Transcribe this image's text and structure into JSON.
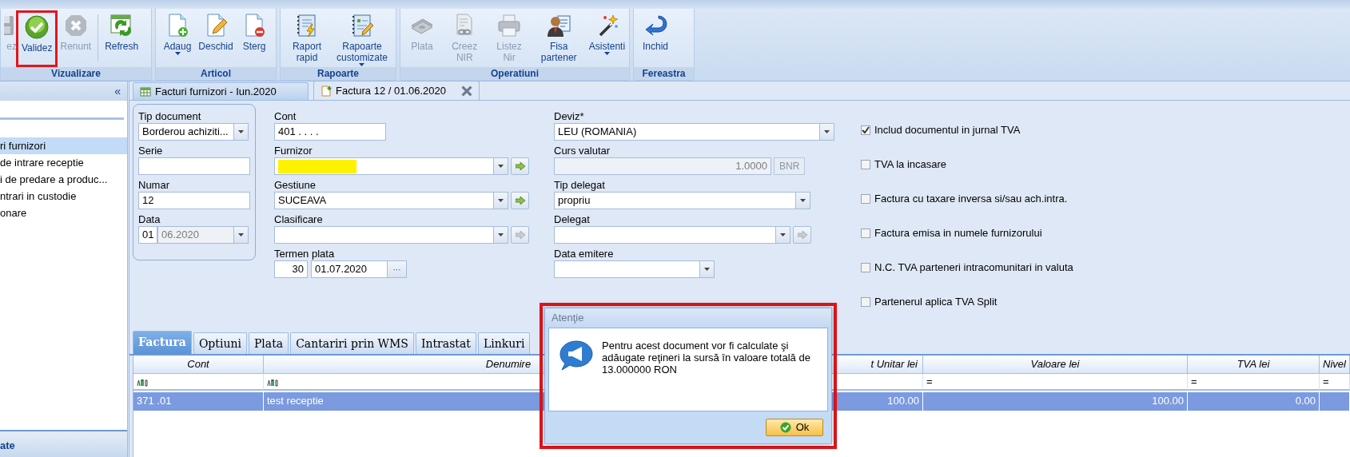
{
  "ribbon": {
    "groups": [
      {
        "label": "Vizualizare",
        "buttons": [
          {
            "label": "ez",
            "disabled": true,
            "highlighted": false,
            "dropdown": false
          },
          {
            "label": "Validez",
            "disabled": false,
            "highlighted": true,
            "dropdown": false
          },
          {
            "label": "Renunt",
            "disabled": true,
            "highlighted": false,
            "dropdown": false
          },
          {
            "label": "Refresh",
            "disabled": false,
            "highlighted": false,
            "dropdown": false
          }
        ]
      },
      {
        "label": "Articol",
        "buttons": [
          {
            "label": "Adaug",
            "disabled": false,
            "highlighted": false,
            "dropdown": true
          },
          {
            "label": "Deschid",
            "disabled": false,
            "highlighted": false,
            "dropdown": false
          },
          {
            "label": "Sterg",
            "disabled": false,
            "highlighted": false,
            "dropdown": false
          }
        ]
      },
      {
        "label": "Rapoarte",
        "buttons": [
          {
            "label": "Raport rapid",
            "disabled": false,
            "highlighted": false,
            "dropdown": false
          },
          {
            "label": "Rapoarte customizate",
            "disabled": false,
            "highlighted": false,
            "dropdown": true
          }
        ]
      },
      {
        "label": "Operatiuni",
        "buttons": [
          {
            "label": "Plata",
            "disabled": true,
            "highlighted": false,
            "dropdown": false
          },
          {
            "label": "Creez NIR",
            "disabled": true,
            "highlighted": false,
            "dropdown": false
          },
          {
            "label": "Listez Nir",
            "disabled": true,
            "highlighted": false,
            "dropdown": false
          },
          {
            "label": "Fisa partener",
            "disabled": false,
            "highlighted": false,
            "dropdown": false
          },
          {
            "label": "Asistenti",
            "disabled": false,
            "highlighted": false,
            "dropdown": true
          }
        ]
      },
      {
        "label": "Fereastra",
        "buttons": [
          {
            "label": "Inchid",
            "disabled": false,
            "highlighted": false,
            "dropdown": false
          }
        ]
      }
    ]
  },
  "sidebar": {
    "collapse": "«",
    "items": [
      {
        "label": "ri furnizori",
        "selected": true
      },
      {
        "label": "de intrare receptie",
        "selected": false
      },
      {
        "label": "i de predare a produc...",
        "selected": false
      },
      {
        "label": "ntrari in custodie",
        "selected": false
      },
      {
        "label": "onare",
        "selected": false
      }
    ],
    "footer": "ate"
  },
  "doc_tabs": [
    {
      "label": "Facturi furnizori - Iun.2020",
      "selected": false,
      "closable": false
    },
    {
      "label": "Factura 12 / 01.06.2020",
      "selected": true,
      "closable": true
    }
  ],
  "form": {
    "group": [
      {
        "label": "Tip document",
        "kind": "combo",
        "value": "Borderou achiziti..."
      },
      {
        "label": "Serie",
        "kind": "text"
      },
      {
        "label": "Numar",
        "kind": "text",
        "value": "12"
      },
      {
        "label": "Data",
        "kind": "date",
        "day": "01",
        "value": "06.2020",
        "disabled": true
      }
    ],
    "middle": [
      {
        "label": "Cont",
        "kind": "text",
        "value": "401 . . . ."
      },
      {
        "label": "Furnizor",
        "kind": "combo",
        "redacted": true,
        "arrow_disabled": false
      },
      {
        "label": "Gestiune",
        "kind": "combo",
        "value": "SUCEAVA",
        "arrow_disabled": false
      },
      {
        "label": "Clasificare",
        "kind": "combo",
        "arrow_disabled": true
      },
      {
        "label": "Termen plata",
        "kind": "term",
        "days": "30",
        "value": "01.07.2020",
        "button": "···"
      }
    ],
    "right": [
      {
        "label": "Deviz*",
        "kind": "combo",
        "value": "LEU (ROMANIA)"
      },
      {
        "label": "Curs valutar",
        "kind": "rate",
        "value": "1.0000",
        "button": "BNR",
        "disabled": true
      },
      {
        "label": "Tip delegat",
        "kind": "combo",
        "value": "propriu"
      },
      {
        "label": "Delegat",
        "kind": "combo",
        "arrow_disabled": true
      },
      {
        "label": "Data emitere",
        "kind": "combo"
      }
    ],
    "checkboxes": [
      {
        "label": "Includ documentul in jurnal TVA",
        "checked": true
      },
      {
        "label": "TVA la incasare",
        "checked": false
      },
      {
        "label": "Factura cu taxare inversa si/sau ach.intra.",
        "checked": false
      },
      {
        "label": "Factura emisa in numele furnizorului",
        "checked": false
      },
      {
        "label": "N.C. TVA parteneri intracomunitari in valuta",
        "checked": false
      },
      {
        "label": "Partenerul aplica TVA Split",
        "checked": false
      }
    ]
  },
  "bottom_tabs": [
    {
      "label": "Factura",
      "selected": true
    },
    {
      "label": "Optiuni",
      "selected": false
    },
    {
      "label": "Plata",
      "selected": false
    },
    {
      "label": "Cantariri prin WMS",
      "selected": false
    },
    {
      "label": "Intrastat",
      "selected": false
    },
    {
      "label": "Linkuri",
      "selected": false
    }
  ],
  "table": {
    "columns": [
      {
        "label": "Cont",
        "text_filter": true
      },
      {
        "label": "Denumire",
        "text_filter": true
      },
      {
        "label": "t Unitar lei"
      },
      {
        "label": "Valoare lei",
        "filter": "="
      },
      {
        "label": "TVA lei",
        "filter": "="
      },
      {
        "label": "Nivel",
        "filter": "="
      }
    ],
    "rows": [
      {
        "cells": [
          "371 .01",
          "test receptie",
          "100.00",
          "100.00",
          "0.00"
        ],
        "selected": true
      }
    ]
  },
  "dialog": {
    "title": "Atenţie",
    "message": "Pentru acest document vor fi calculate şi adăugate reţineri la sursă în valoare totală de 13.000000 RON",
    "button": "Ok",
    "highlighted": true
  }
}
